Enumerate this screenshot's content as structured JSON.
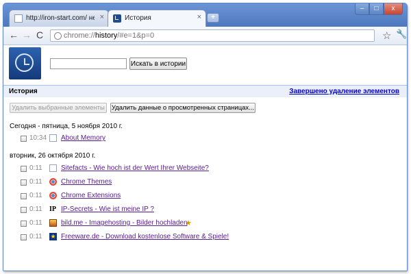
{
  "tabs": [
    {
      "title": "http://iron-start.com/ нед...",
      "close": "×"
    },
    {
      "title": "История",
      "close": "×"
    }
  ],
  "new_tab_label": "+",
  "window_buttons": {
    "minimize": "–",
    "maximize": "□",
    "close": "x"
  },
  "nav": {
    "back": "←",
    "forward": "→",
    "reload": "C"
  },
  "omnibox": {
    "scheme": "chrome://",
    "host": "history",
    "path": "/#e=1&p=0"
  },
  "toolbar_icons": {
    "star": "star-icon",
    "wrench": "wrench-icon"
  },
  "search": {
    "value": "",
    "button": "Искать в истории"
  },
  "section": {
    "title": "История",
    "status": "Завершено удаление элементов"
  },
  "actions": {
    "delete_selected": "Удалить выбранные элементы",
    "clear_data": "Удалить данные о просмотренных страницах..."
  },
  "days": [
    {
      "label": "Сегодня - пятница, 5 ноября 2010 г.",
      "entries": [
        {
          "time": "10:34",
          "title": "About Memory",
          "icon": "page"
        }
      ]
    },
    {
      "label": "вторник, 26 октября 2010 г.",
      "entries": [
        {
          "time": "0:11",
          "title": "Sitefacts - Wie hoch ist der Wert Ihrer Webseite?",
          "icon": "page"
        },
        {
          "time": "0:11",
          "title": "Chrome Themes",
          "icon": "chrome"
        },
        {
          "time": "0:11",
          "title": "Chrome Extensions",
          "icon": "chrome"
        },
        {
          "time": "0:11",
          "title": "IP-Secrets - Wie ist meine IP ?",
          "icon": "ip"
        },
        {
          "time": "0:11",
          "title": "bild.me - Imagehosting - Bilder hochladen",
          "icon": "bild",
          "starred": true
        },
        {
          "time": "0:11",
          "title": "Freeware.de - Download kostenlose Software & Spiele!",
          "icon": "freeware"
        }
      ]
    }
  ],
  "entry_glyphs": {
    "ip": "IP",
    "freeware": "★",
    "bookmark_star": "★"
  },
  "colors": {
    "link_visited": "#551a8b",
    "status_link": "#0000cc",
    "section_bg": "#ebeff9",
    "titlebar": "#5f86c4"
  }
}
